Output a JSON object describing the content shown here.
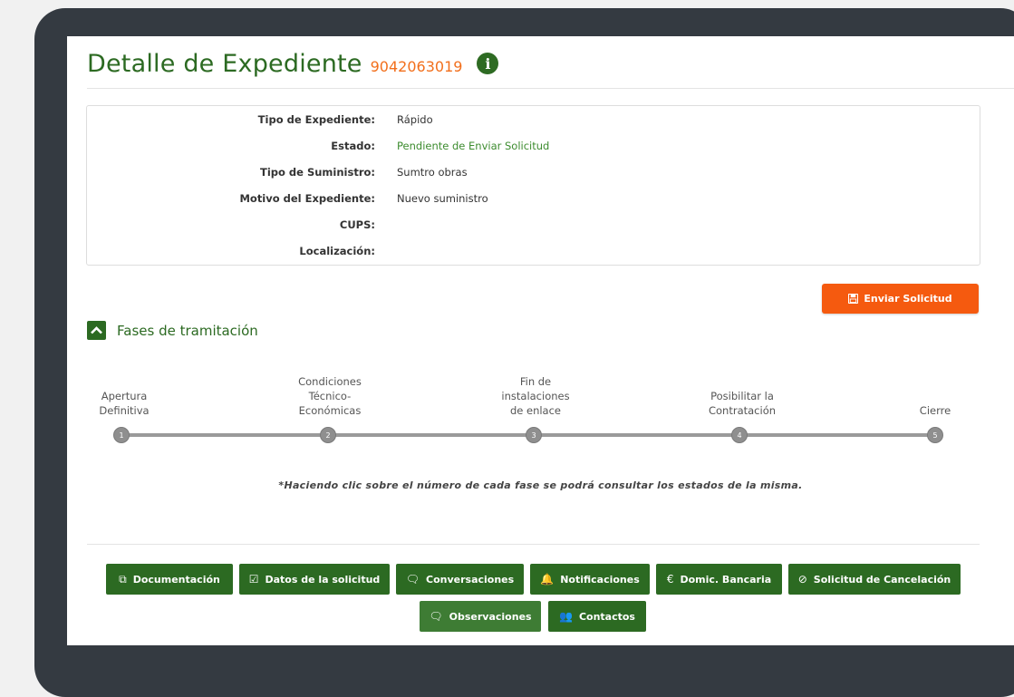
{
  "header": {
    "title": "Detalle de Expediente",
    "expediente_number": "9042063019",
    "info_icon_glyph": "i"
  },
  "details": [
    {
      "label": "Tipo de Expediente:",
      "value": "Rápido"
    },
    {
      "label": "Estado:",
      "value": "Pendiente de Enviar Solicitud"
    },
    {
      "label": "Tipo de Suministro:",
      "value": "Sumtro obras"
    },
    {
      "label": "Motivo del Expediente:",
      "value": "Nuevo suministro"
    },
    {
      "label": "CUPS:",
      "value": ""
    },
    {
      "label": "Localización:",
      "value": ""
    }
  ],
  "send_button": {
    "label": "Enviar Solicitud",
    "icon": "floppy-disk-icon"
  },
  "phases": {
    "title": "Fases de tramitación",
    "items": [
      {
        "number": "1",
        "label_lines": [
          "Apertura",
          "Definitiva"
        ]
      },
      {
        "number": "2",
        "label_lines": [
          "Condiciones",
          "Técnico-",
          "Económicas"
        ]
      },
      {
        "number": "3",
        "label_lines": [
          "Fin de",
          "instalaciones",
          "de enlace"
        ]
      },
      {
        "number": "4",
        "label_lines": [
          "Posibilitar la",
          "Contratación"
        ]
      },
      {
        "number": "5",
        "label_lines": [
          "Cierre"
        ]
      }
    ],
    "note": "*Haciendo clic sobre el número de cada fase se podrá consultar los estados de la misma."
  },
  "actions": [
    {
      "label": "Documentación",
      "icon": "copy-icon",
      "glyph": "⧉"
    },
    {
      "label": "Datos de la solicitud",
      "icon": "check-square-icon",
      "glyph": "☑"
    },
    {
      "label": "Conversaciones",
      "icon": "chat-bubbles-icon",
      "glyph": "🗨"
    },
    {
      "label": "Notificaciones",
      "icon": "bell-icon",
      "glyph": "🔔"
    },
    {
      "label": "Domic. Bancaria",
      "icon": "euro-icon",
      "glyph": "€"
    },
    {
      "label": "Solicitud de Cancelación",
      "icon": "ban-icon",
      "glyph": "⊘"
    },
    {
      "label": "Observaciones",
      "icon": "chat-bubbles-icon",
      "glyph": "🗨"
    },
    {
      "label": "Contactos",
      "icon": "users-icon",
      "glyph": "👥"
    }
  ],
  "colors": {
    "brand_green": "#2c6a22",
    "accent_orange": "#f55a0f",
    "status_green": "#3d8c2f",
    "frame_dark": "#343a41"
  }
}
